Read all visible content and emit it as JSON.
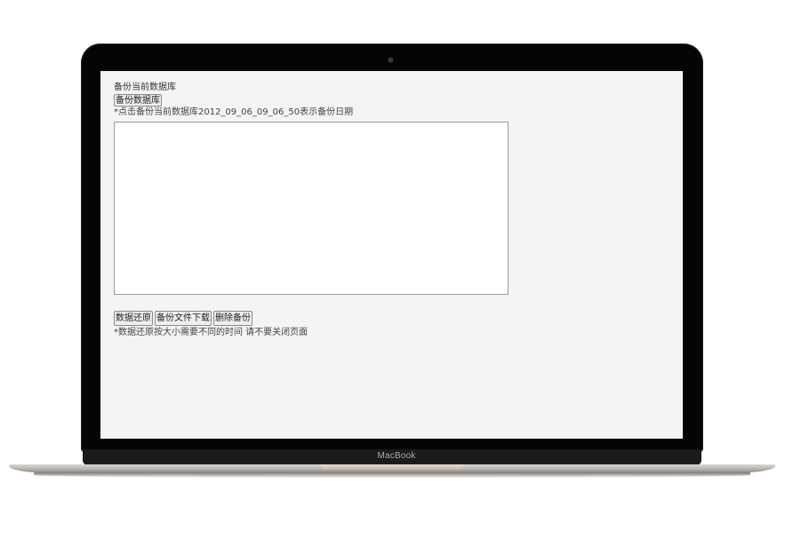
{
  "device": {
    "brand": "MacBook"
  },
  "backup": {
    "title": "备份当前数据库",
    "button_label": "备份数据库",
    "hint": "*点击备份当前数据库2012_09_06_09_06_50表示备份日期"
  },
  "restore": {
    "buttons": [
      {
        "label": "数据还原"
      },
      {
        "label": "备份文件下载"
      },
      {
        "label": "删除备份"
      }
    ],
    "hint": "*数据还原按大小需要不同的时间 请不要关闭页面"
  }
}
